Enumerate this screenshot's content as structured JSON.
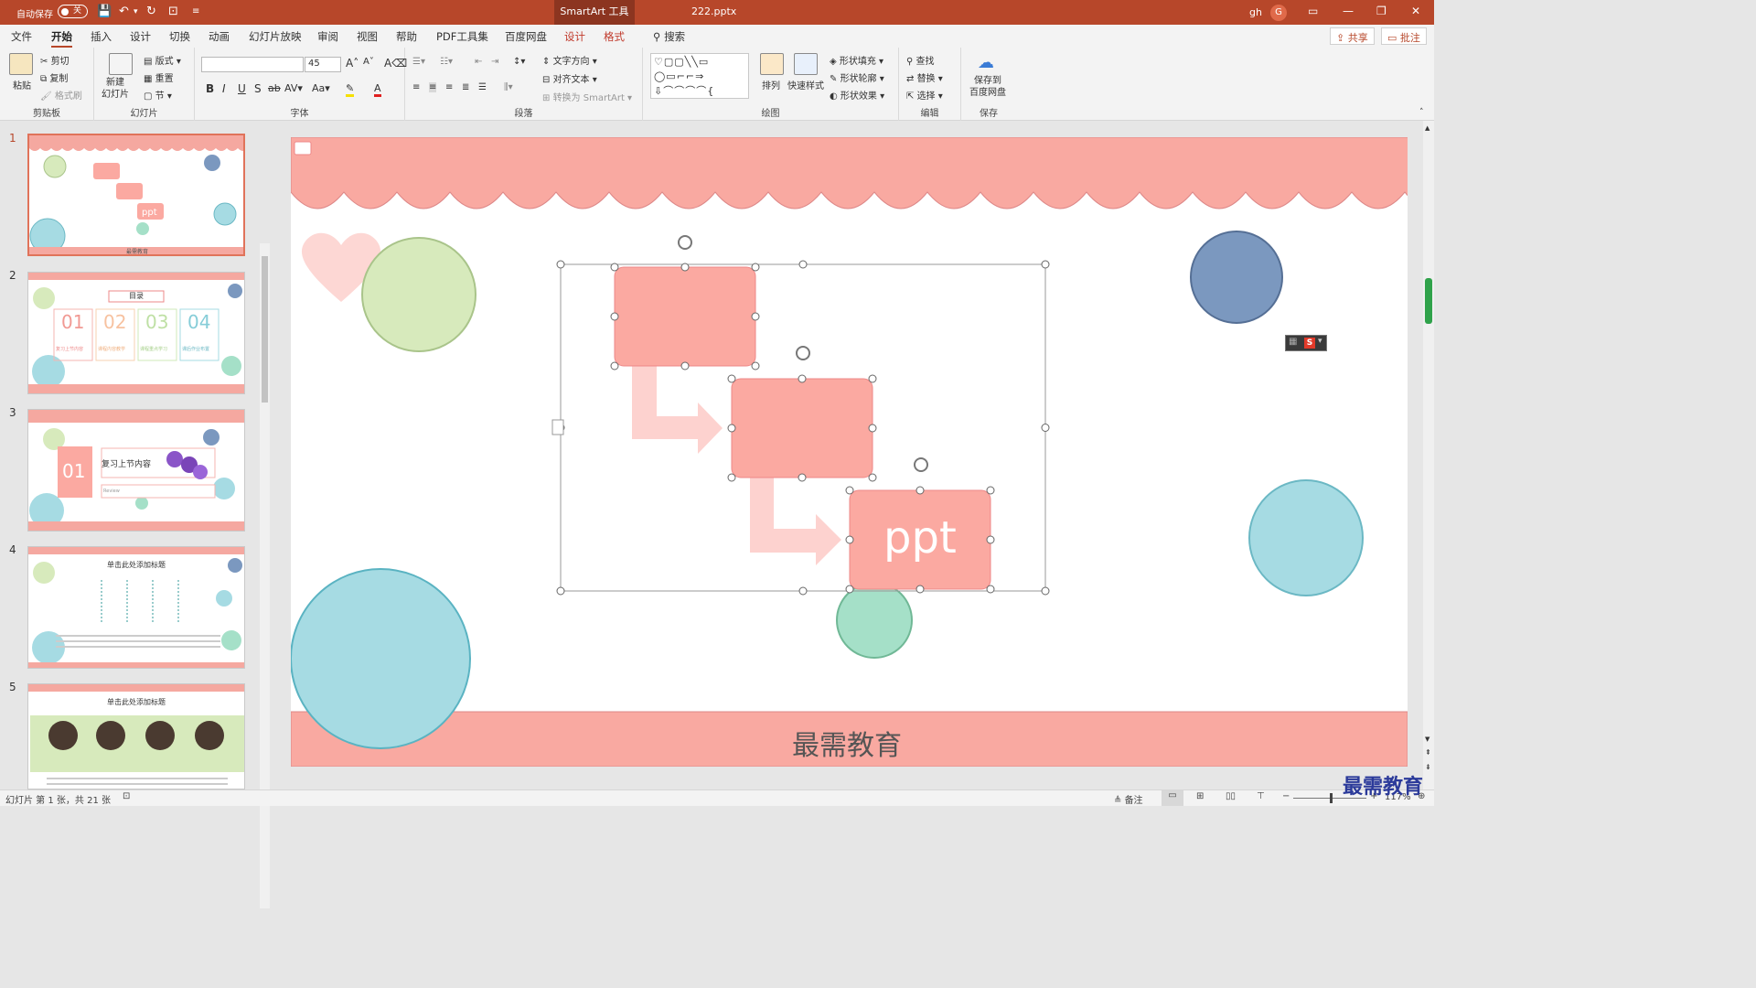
{
  "titlebar": {
    "autosave_label": "自动保存",
    "autosave_state": "关",
    "context_tab": "SmartArt 工具",
    "filename": "222.pptx",
    "user": "gh",
    "avatar_letter": "G"
  },
  "menu": {
    "tabs": [
      "文件",
      "开始",
      "插入",
      "设计",
      "切换",
      "动画",
      "幻灯片放映",
      "审阅",
      "视图",
      "帮助",
      "PDF工具集",
      "百度网盘"
    ],
    "context_tabs": [
      "设计",
      "格式"
    ],
    "active": "开始",
    "search": "搜索",
    "share": "共享",
    "comment": "批注"
  },
  "ribbon": {
    "clipboard": {
      "label": "剪贴板",
      "paste": "粘贴",
      "cut": "剪切",
      "copy": "复制",
      "format_painter": "格式刷"
    },
    "slides": {
      "label": "幻灯片",
      "new_slide": "新建\n幻灯片",
      "layout": "版式",
      "reset": "重置",
      "section": "节"
    },
    "font": {
      "label": "字体",
      "size": "45",
      "font_name": ""
    },
    "paragraph": {
      "label": "段落",
      "text_direction": "文字方向",
      "align_text": "对齐文本",
      "convert_smartart": "转换为 SmartArt"
    },
    "drawing": {
      "label": "绘图",
      "arrange": "排列",
      "quick_styles": "快速样式",
      "shape_fill": "形状填充",
      "shape_outline": "形状轮廓",
      "shape_effects": "形状效果"
    },
    "editing": {
      "label": "编辑",
      "find": "查找",
      "replace": "替换",
      "select": "选择"
    },
    "save": {
      "label": "保存",
      "save_to_baidu": "保存到\n百度网盘"
    }
  },
  "thumbnails": [
    {
      "num": "1",
      "boxtext": "ppt",
      "footer": "最需教育"
    },
    {
      "num": "2",
      "title": "目录",
      "items": [
        "01",
        "02",
        "03",
        "04"
      ],
      "captions": [
        "复习上节内容",
        "课程内容教学",
        "课程重点学习",
        "课后作业布置"
      ]
    },
    {
      "num": "3",
      "number": "01",
      "title": "复习上节内容",
      "sub": "Review"
    },
    {
      "num": "4",
      "title": "单击此处添加标题"
    },
    {
      "num": "5",
      "title": "单击此处添加标题"
    }
  ],
  "slide": {
    "box3_text": "ppt",
    "footer_text": "最需教育"
  },
  "status": {
    "slide_info": "幻灯片 第 1 张，共 21 张",
    "notes": "备注",
    "zoom": "117%"
  },
  "watermark": "最需教育",
  "colors": {
    "accent": "#b7472a",
    "salmon": "#f5a8a0",
    "box": "#fba9a1",
    "green": "#d7eabc",
    "blue": "#7b98bf",
    "cyan": "#a6dbe3",
    "mint": "#a5e0c8"
  }
}
